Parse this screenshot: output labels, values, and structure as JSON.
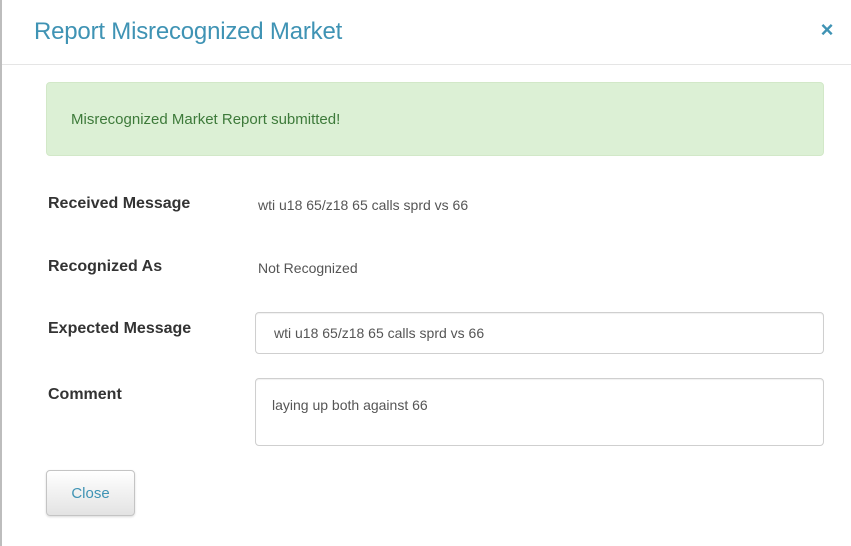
{
  "modal": {
    "title": "Report Misrecognized Market",
    "close_icon": "×"
  },
  "alert": {
    "message": "Misrecognized Market Report submitted!",
    "color": "#dcf0d5"
  },
  "fields": {
    "received_message": {
      "label": "Received Message",
      "value": "wti u18 65/z18 65 calls sprd vs 66"
    },
    "recognized_as": {
      "label": "Recognized As",
      "value": "Not Recognized"
    },
    "expected_message": {
      "label": "Expected Message",
      "value": "wti u18 65/z18 65 calls sprd vs 66"
    },
    "comment": {
      "label": "Comment",
      "value": "laying up both against 66"
    }
  },
  "footer": {
    "close_label": "Close"
  },
  "colors": {
    "accent": "#3f93b4",
    "success_text": "#3d7a3a"
  }
}
